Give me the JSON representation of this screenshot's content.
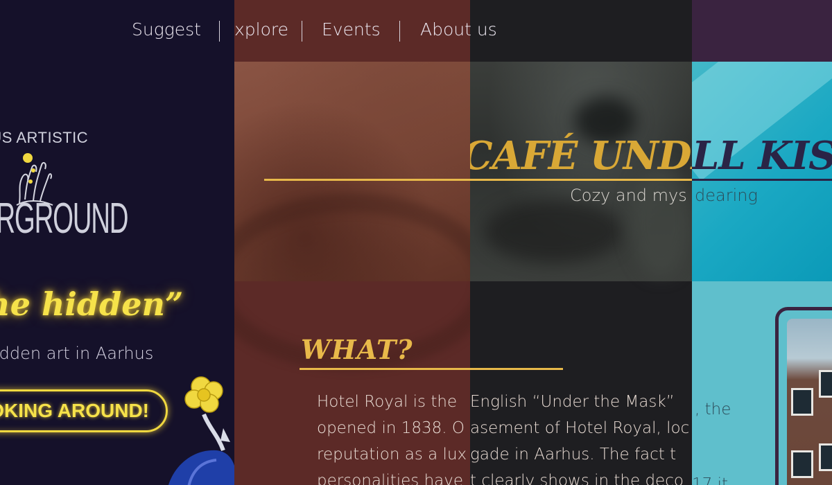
{
  "nav": {
    "suggest": "Suggest",
    "explore": "xplore",
    "events": "Events",
    "about": "About us"
  },
  "landing": {
    "logo_top": "HUS ARTISTIC",
    "logo_bottom": "ERGROUND",
    "tagline": "the hidden”",
    "subline": "idden art in Aarhus",
    "cta": "OKING AROUND!"
  },
  "cafe_panel": {
    "title": "CAFÉ UNDER",
    "subtitle": "Cozy and mys"
  },
  "kiss_panel": {
    "title": "LL KISS",
    "subtitle": "dearing",
    "frag_the": ", the",
    "frag_bottom": "17 it"
  },
  "what_section": {
    "heading": "WHAT?",
    "p2_lines": [
      "Hotel Royal is the",
      "opened in 1838. O",
      "reputation as a lux",
      "personalities have"
    ],
    "p3_lines": [
      " English “Under the Mask”",
      "asement of Hotel Royal, loc",
      "gade in Aarhus. The fact t",
      "t clearly shows in the deco"
    ]
  },
  "colors": {
    "gold": "#e8b94a",
    "neon": "#f6e24a",
    "brown": "#5c2a27",
    "charcoal": "#1e1e21",
    "teal": "#5fbfcc",
    "plum": "#3a2340"
  }
}
